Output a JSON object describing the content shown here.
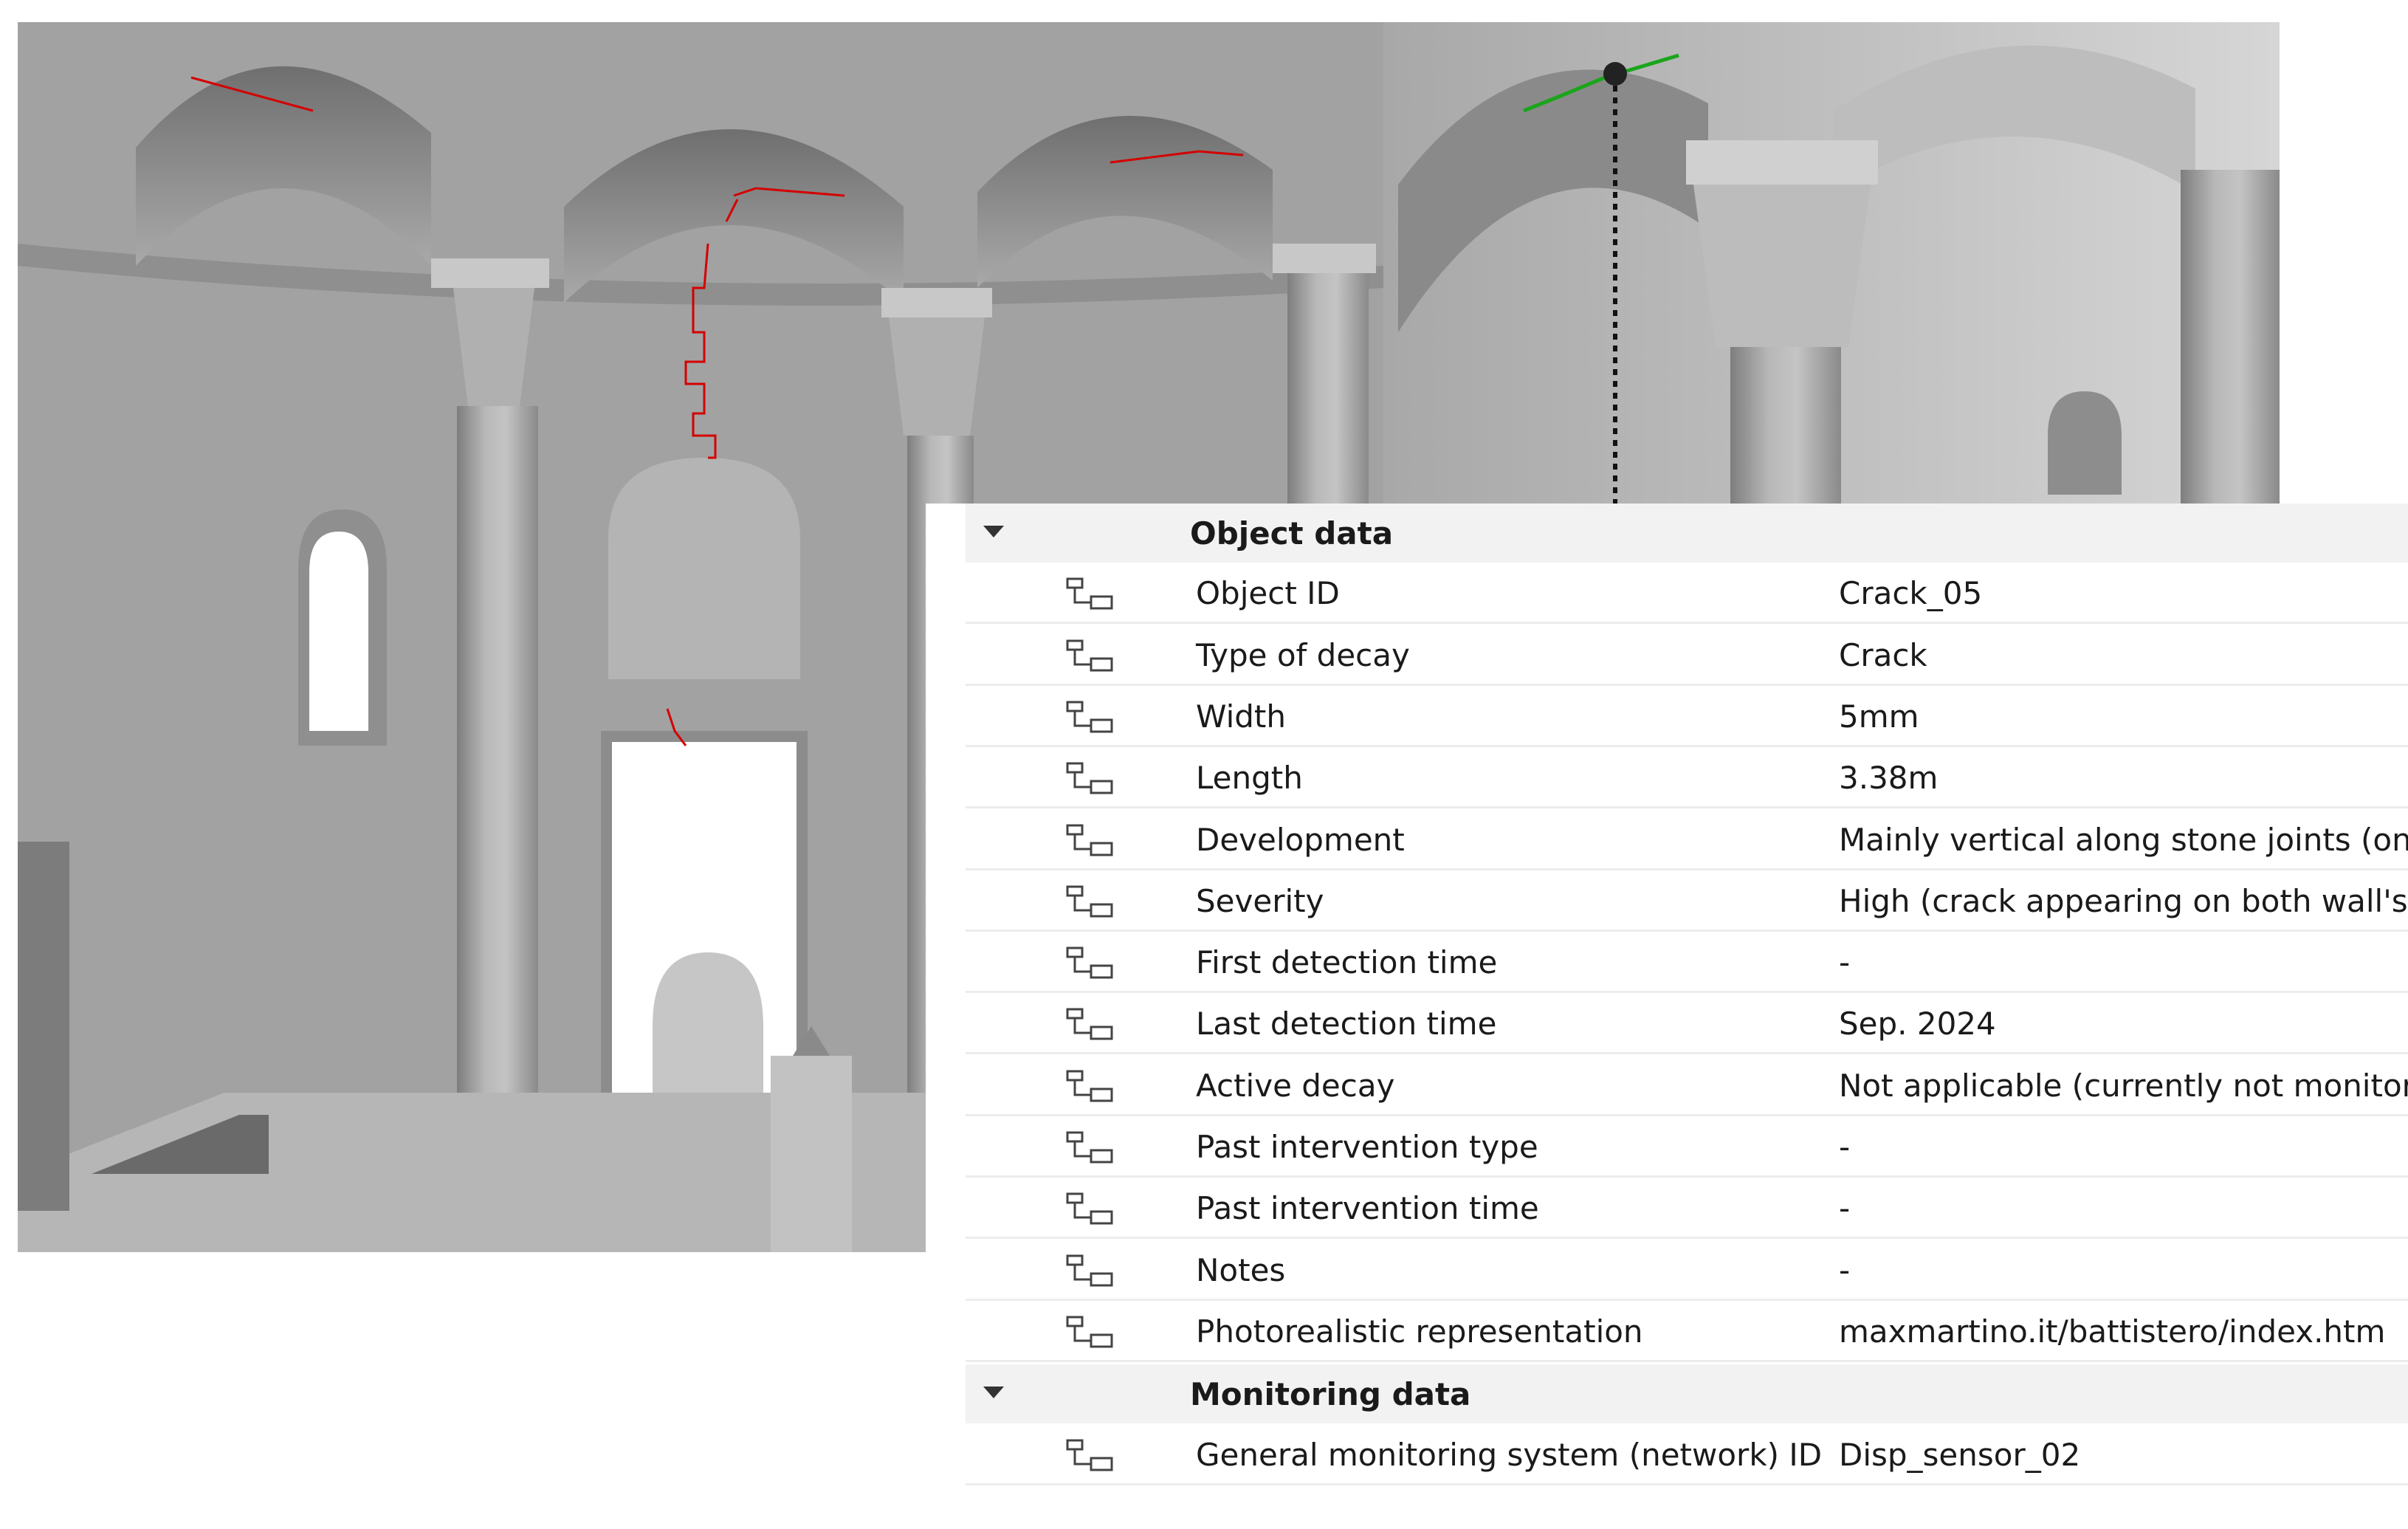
{
  "colors": {
    "panel_bg": "#ffffff",
    "section_bg": "#f2f2f2",
    "row_divider": "#ececec",
    "crack_red": "#d40000",
    "selected_crack_green": "#1aa51a",
    "model_gray": "#9c9c9c"
  },
  "viewport": {
    "description_icon": "3d-model-view"
  },
  "properties_panel": {
    "sections": [
      {
        "label": "Object data",
        "rows": [
          {
            "name": "Object ID",
            "value": "Crack_05"
          },
          {
            "name": "Type of decay",
            "value": "Crack"
          },
          {
            "name": "Width",
            "value": "5mm"
          },
          {
            "name": "Length",
            "value": "3.38m"
          },
          {
            "name": "Development",
            "value": "Mainly vertical along stone joints (onl"
          },
          {
            "name": "Severity",
            "value": "High (crack appearing on both wall's"
          },
          {
            "name": "First detection time",
            "value": "-"
          },
          {
            "name": "Last detection time",
            "value": "Sep. 2024"
          },
          {
            "name": "Active decay",
            "value": "Not applicable (currently not monitor"
          },
          {
            "name": "Past intervention type",
            "value": "-"
          },
          {
            "name": "Past intervention time",
            "value": "-"
          },
          {
            "name": "Notes",
            "value": "-"
          },
          {
            "name": "Photorealistic representation",
            "value": "maxmartino.it/battistero/index.htm"
          }
        ]
      },
      {
        "label": "Monitoring data",
        "rows": [
          {
            "name": "General monitoring system (network) ID",
            "value": "Disp_sensor_02"
          }
        ]
      }
    ],
    "row_icon": "property-link-icon",
    "toggle_icon": "collapse-triangle-icon"
  }
}
